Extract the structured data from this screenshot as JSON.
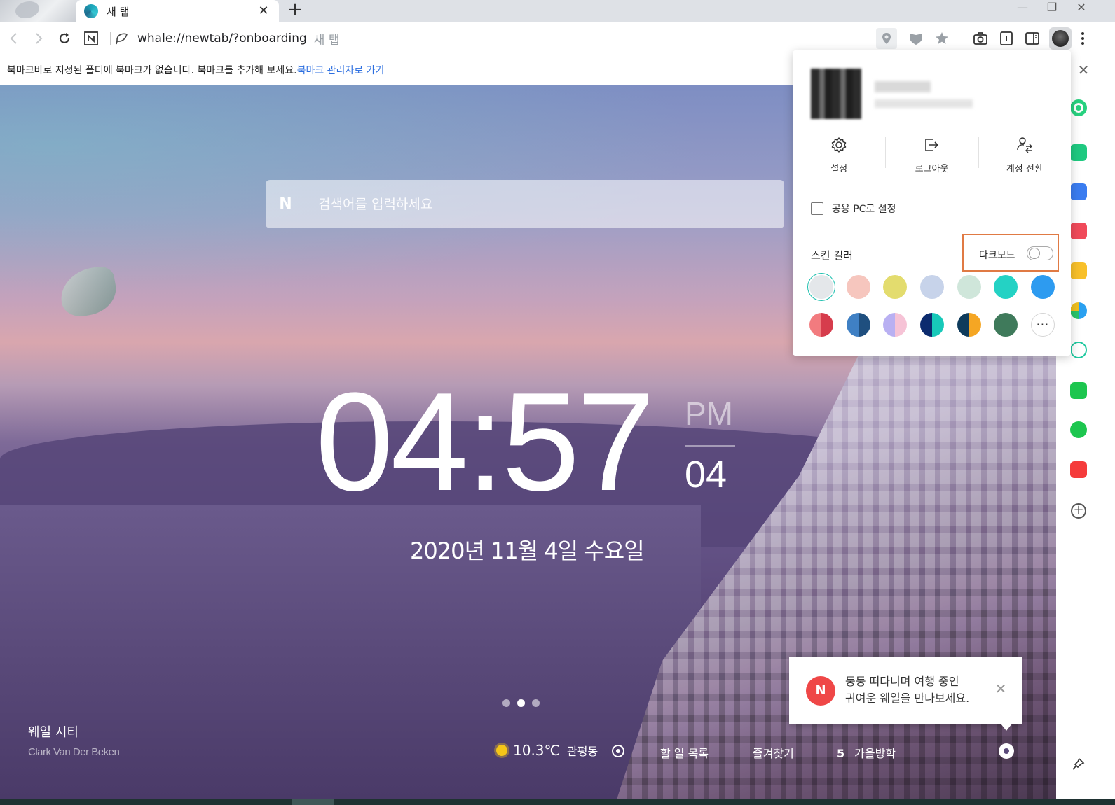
{
  "tabs": [
    {
      "title": "새 탭",
      "close": "✕"
    }
  ],
  "new_tab": "+",
  "window_controls": {
    "minimize": "—",
    "restore": "❐",
    "close": "✕"
  },
  "address_bar": {
    "url": "whale://newtab/?onboarding",
    "page_label": "새 탭"
  },
  "bookmark_bar": {
    "message": "북마크바로 지정된 폴더에 북마크가 없습니다. 북마크를 추가해 보세요.",
    "link": "북마크 관리자로 가기",
    "close": "✕"
  },
  "search": {
    "logo": "N",
    "placeholder": "검색어를 입력하세요"
  },
  "clock": {
    "hours": "04",
    "minutes": "57",
    "ampm": "PM",
    "seconds": "04",
    "date": "2020년 11월 4일 수요일"
  },
  "carousel": {
    "count": 3,
    "active_index": 1
  },
  "credit": {
    "title": "웨일 시티",
    "author": "Clark Van Der Beken"
  },
  "bottom_bar": {
    "temperature": "10.3℃",
    "location": "관평동",
    "todo": "할 일 목록",
    "favorites": "즐겨찾기",
    "holiday_count": "5",
    "holiday": "가을방학"
  },
  "toast": {
    "icon": "N",
    "line1": "둥둥 떠다니며 여행 중인",
    "line2": "귀여운 웨일을 만나보세요.",
    "close": "✕"
  },
  "profile_menu": {
    "actions": [
      {
        "label": "설정",
        "icon": "gear-icon"
      },
      {
        "label": "로그아웃",
        "icon": "logout-icon"
      },
      {
        "label": "계정 전환",
        "icon": "switch-account-icon"
      }
    ],
    "public_pc": "공용 PC로 설정",
    "public_pc_checked": false,
    "skin_color": "스킨 컬러",
    "dark_mode": "다크모드",
    "dark_mode_on": false,
    "swatches_row1": [
      "#e4e7ea",
      "#f6c6be",
      "#e3dc6e",
      "#c7d3ea",
      "#cfe6da",
      "#24d2c4",
      "#2d9bf0"
    ],
    "swatches_row2": [
      [
        "#f27b7f",
        "#d63c4c"
      ],
      [
        "#3f80c4",
        "#1f4f7f"
      ],
      [
        "#b9b0f2",
        "#f6c3d6"
      ],
      [
        "#0c2b6e",
        "#17c9b9"
      ],
      [
        "#0e3b5c",
        "#f5a623"
      ],
      [
        "#3f7a5b",
        "#3f7a5b"
      ]
    ],
    "more": "···"
  },
  "colors": {
    "accent_link": "#2d6fe0",
    "highlight_border": "#e07a44",
    "arrow": "#de6942",
    "toast_red": "#ef4747"
  }
}
